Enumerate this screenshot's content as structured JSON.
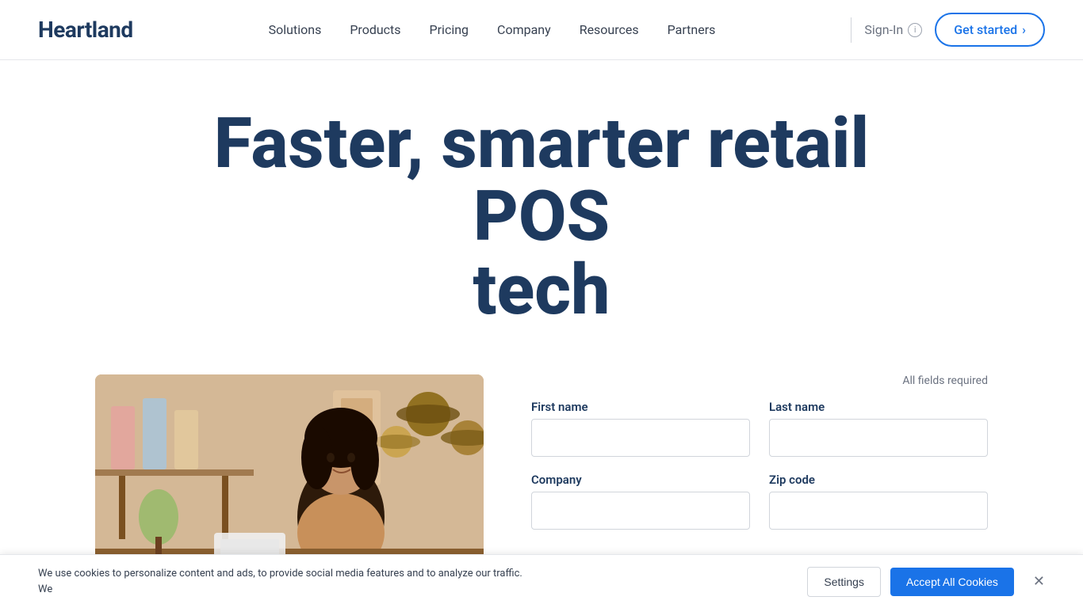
{
  "header": {
    "logo": "Heartland",
    "nav": {
      "items": [
        {
          "label": "Solutions",
          "id": "solutions"
        },
        {
          "label": "Products",
          "id": "products"
        },
        {
          "label": "Pricing",
          "id": "pricing"
        },
        {
          "label": "Company",
          "id": "company"
        },
        {
          "label": "Resources",
          "id": "resources"
        },
        {
          "label": "Partners",
          "id": "partners"
        }
      ]
    },
    "sign_in": "Sign-In",
    "info_icon": "i",
    "get_started": "Get started",
    "chevron": "›"
  },
  "hero": {
    "title_line1": "Faster, smarter retail POS",
    "title_line2": "tech"
  },
  "form": {
    "all_fields_required": "All fields required",
    "fields": [
      {
        "label": "First name",
        "id": "first-name",
        "placeholder": ""
      },
      {
        "label": "Last name",
        "id": "last-name",
        "placeholder": ""
      },
      {
        "label": "Company",
        "id": "company",
        "placeholder": ""
      },
      {
        "label": "Zip code",
        "id": "zip-code",
        "placeholder": ""
      }
    ]
  },
  "cookie_banner": {
    "text": "We use cookies to personalize content and ads, to provide social media features and to analyze our traffic. We",
    "settings_label": "Settings",
    "accept_label": "Accept All Cookies"
  }
}
